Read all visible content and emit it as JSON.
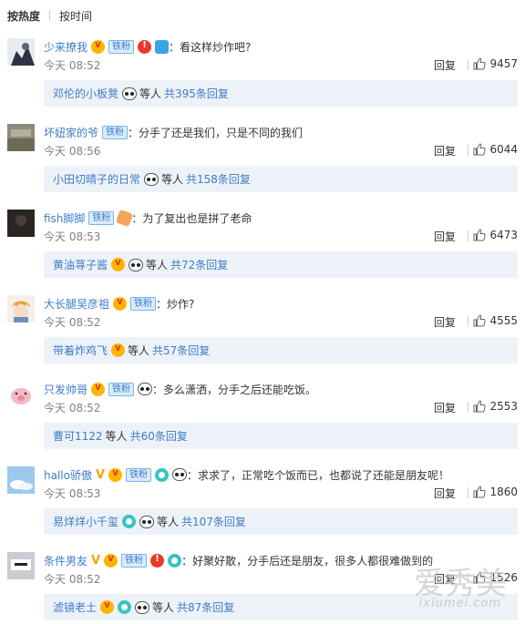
{
  "sort_tabs": {
    "hot": "按热度",
    "time": "按时间"
  },
  "colors": {
    "link": "#3d7cc9",
    "reply_bg": "#edf2f8",
    "time": "#808080"
  },
  "watermark": {
    "main": "爱秀美",
    "sub": "ixiumei.com"
  },
  "comments": [
    {
      "user": "少来撩我",
      "badge": "铁粉",
      "text": "：看这样炒作吧?",
      "time": "今天 08:52",
      "reply_label": "回复",
      "likes": "9457",
      "reply_preview": {
        "name": "邓伦的小板凳",
        "etc": "等人",
        "count": "共395条回复"
      }
    },
    {
      "user": "坏妞家的爷",
      "badge": "铁粉",
      "text": "：分手了还是我们，只是不同的我们",
      "time": "今天 08:56",
      "reply_label": "回复",
      "likes": "6044",
      "reply_preview": {
        "name": "小田切晴子的日常",
        "etc": "等人",
        "count": "共158条回复"
      }
    },
    {
      "user": "fish脚脚",
      "badge": "铁粉",
      "text": "：为了复出也是拼了老命",
      "time": "今天 08:53",
      "reply_label": "回复",
      "likes": "6473",
      "reply_preview": {
        "name": "黄油荨子酱",
        "etc": "等人",
        "count": "共72条回复"
      }
    },
    {
      "user": "大长腿吴彦祖",
      "badge": "铁粉",
      "text": "：炒作?",
      "time": "今天 08:52",
      "reply_label": "回复",
      "likes": "4555",
      "reply_preview": {
        "name": "带着炸鸡飞",
        "etc": "等人",
        "count": "共57条回复"
      }
    },
    {
      "user": "只发帅哥",
      "badge": "铁粉",
      "text": "：多么潇洒，分手之后还能吃饭。",
      "time": "今天 08:52",
      "reply_label": "回复",
      "likes": "2553",
      "reply_preview": {
        "name": "曹可1122",
        "etc": "等人",
        "count": "共60条回复"
      }
    },
    {
      "user": "hallo骄傲",
      "badge": "铁粉",
      "text": "：求求了，正常吃个饭而已，也都说了还能是朋友呢！",
      "time": "今天 08:53",
      "reply_label": "回复",
      "likes": "1860",
      "reply_preview": {
        "name": "易烊烊小千玺",
        "etc": "等人",
        "count": "共107条回复"
      }
    },
    {
      "user": "条件男友",
      "badge": "铁粉",
      "text": "：好聚好散，分手后还是朋友，很多人都很难做到的",
      "time": "今天 08:52",
      "reply_label": "回复",
      "likes": "1526",
      "reply_preview": {
        "name": "滤镜老土",
        "etc": "等人",
        "count": "共87条回复"
      }
    }
  ]
}
